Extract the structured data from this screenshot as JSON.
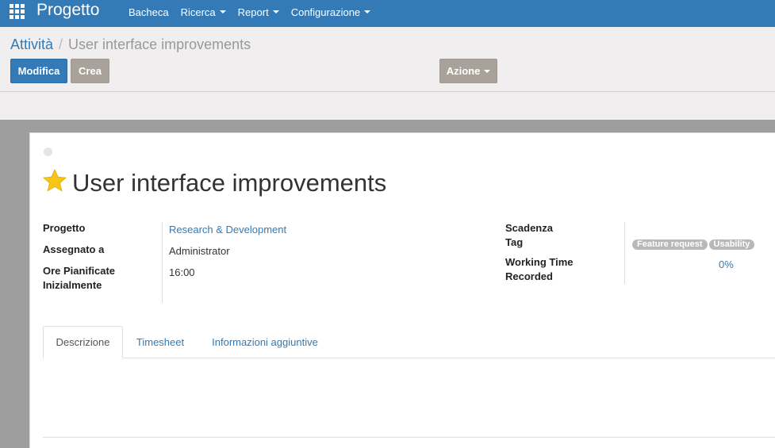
{
  "navbar": {
    "brand": "Progetto",
    "menu": [
      "Bacheca",
      "Ricerca",
      "Report",
      "Configurazione"
    ]
  },
  "breadcrumb": {
    "parent": "Attività",
    "separator": "/",
    "current": "User interface improvements"
  },
  "buttons": {
    "edit": "Modifica",
    "create": "Crea",
    "action": "Azione"
  },
  "record": {
    "title": "User interface improvements",
    "left_fields": [
      {
        "label": "Progetto",
        "value": "Research & Development"
      },
      {
        "label": "Assegnato a",
        "value": "Administrator"
      },
      {
        "label": "Ore Pianificate Inizialmente",
        "value": "16:00"
      }
    ],
    "right_fields": {
      "deadline_label": "Scadenza",
      "tag_label": "Tag",
      "tags": [
        "Feature request",
        "Usability"
      ],
      "working_time_label": "Working Time Recorded",
      "working_time_value": "0%"
    }
  },
  "tabs": [
    "Descrizione",
    "Timesheet",
    "Informazioni aggiuntive"
  ],
  "colors": {
    "navbar": "#337ab7",
    "star": "#f5c518",
    "secondary_button": "#a8a29b"
  }
}
